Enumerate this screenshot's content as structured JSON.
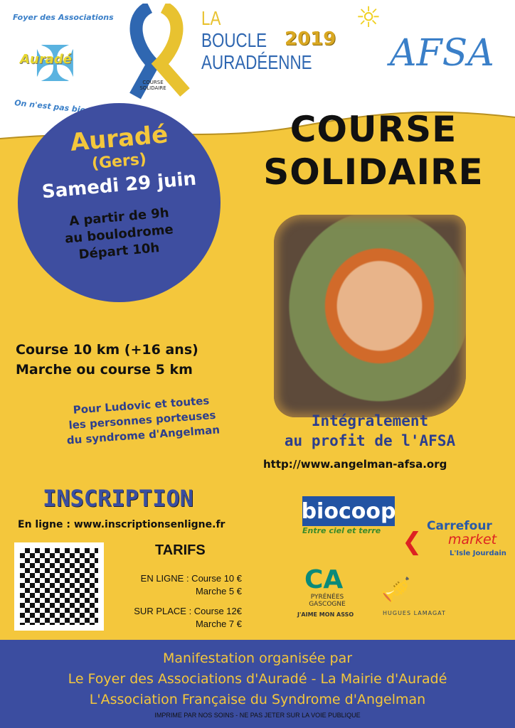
{
  "header": {
    "foyer_top": "Foyer des Associations",
    "foyer_name": "Auradé",
    "foyer_bottom": "On n'est pas bien là ?",
    "ribbon_text": "COURSE SOLIDAIRE",
    "boucle": [
      "LA",
      "BOUCLE",
      "AURADÉENNE"
    ],
    "year": "2019",
    "afsa": "AFSA"
  },
  "title": [
    "COURSE",
    "SOLIDAIRE"
  ],
  "circle": {
    "place": "Auradé",
    "dept": "(Gers)",
    "date": "Samedi 29 juin",
    "info": [
      "A partir de 9h",
      "au boulodrome",
      "Départ 10h"
    ]
  },
  "distances": [
    "Course 10 km (+16 ans)",
    "Marche ou course 5 km"
  ],
  "dedication": [
    "Pour Ludovic et toutes",
    "les personnes porteuses",
    "du syndrome d'Angelman"
  ],
  "profit": [
    "Intégralement",
    "au profit de l'AFSA"
  ],
  "website": "http://www.angelman-afsa.org",
  "inscription": {
    "title": "INSCRIPTION",
    "online": "En ligne : www.inscriptionsenligne.fr"
  },
  "tarifs": {
    "title": "TARIFS",
    "rows": [
      "EN LIGNE : Course 10 €",
      "Marche 5 €",
      "SUR PLACE : Course 12€",
      "Marche 7 €"
    ]
  },
  "sponsors": {
    "biocoop": "biocoop",
    "biocoop_tag": "Entre ciel et terre",
    "carrefour": "Carrefour",
    "market": "market",
    "carrefour_loc": "L'Isle Jourdain",
    "ca": "PYRÉNÉES GASCOGNE",
    "ca_tag": "J'AIME MON ASSO",
    "lamagat": "HUGUES LAMAGAT"
  },
  "footer": {
    "lines": [
      "Manifestation organisée par",
      "Le Foyer des Associations d'Auradé - La Mairie d'Auradé",
      "L'Association Française du Syndrome d'Angelman"
    ],
    "notice": "IMPRIME PAR NOS SOINS - NE PAS JETER SUR LA VOIE PUBLIQUE"
  },
  "colors": {
    "yellow": "#f4c73c",
    "blue": "#3b4da0"
  }
}
